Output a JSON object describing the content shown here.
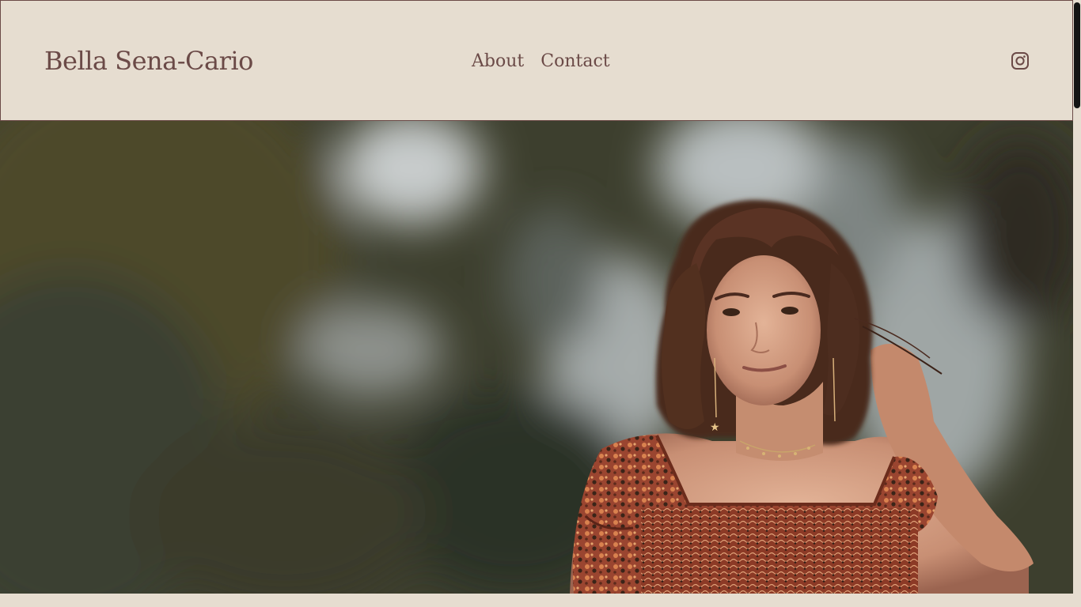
{
  "header": {
    "site_title": "Bella Sena-Cario",
    "nav": [
      {
        "label": "About"
      },
      {
        "label": "Contact"
      }
    ],
    "social_icon": "instagram-icon"
  },
  "hero": {
    "image": "portrait-photo"
  },
  "colors": {
    "background": "#e6ddd0",
    "text": "#6b4a47",
    "header_border": "#6b4a47"
  }
}
